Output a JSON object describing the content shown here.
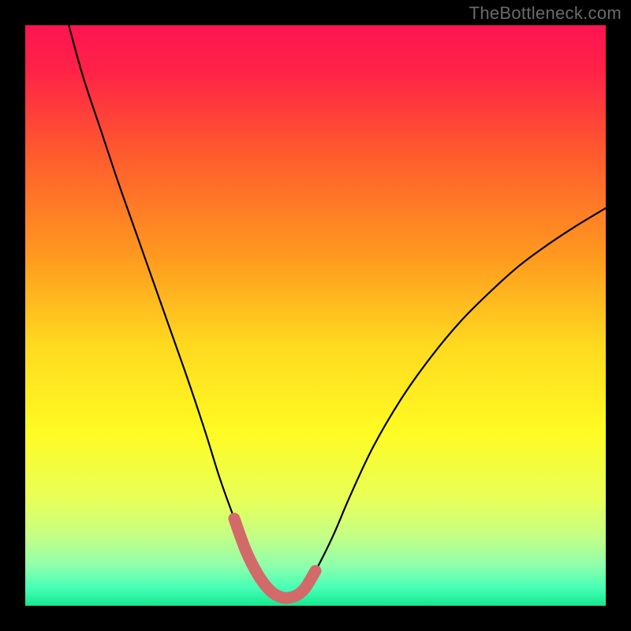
{
  "watermark": "TheBottleneck.com",
  "colors": {
    "frame_bg": "#000000",
    "gradient_stops": [
      {
        "offset": 0.0,
        "color": "#ff1452"
      },
      {
        "offset": 0.08,
        "color": "#ff2347"
      },
      {
        "offset": 0.22,
        "color": "#ff5a2e"
      },
      {
        "offset": 0.4,
        "color": "#ff9a1f"
      },
      {
        "offset": 0.55,
        "color": "#ffd91f"
      },
      {
        "offset": 0.7,
        "color": "#fffb23"
      },
      {
        "offset": 0.82,
        "color": "#e7ff5a"
      },
      {
        "offset": 0.88,
        "color": "#c4ff86"
      },
      {
        "offset": 0.93,
        "color": "#90ffab"
      },
      {
        "offset": 0.97,
        "color": "#44ffb6"
      },
      {
        "offset": 1.0,
        "color": "#17e88f"
      }
    ],
    "curve_stroke": "#000000",
    "highlight_stroke": "#d36a6a"
  },
  "chart_data": {
    "type": "line",
    "title": "",
    "xlabel": "",
    "ylabel": "",
    "xlim": [
      0,
      1
    ],
    "ylim": [
      0,
      1
    ],
    "series": [
      {
        "name": "bottleneck-curve",
        "x": [
          0.075,
          0.1,
          0.13,
          0.16,
          0.19,
          0.22,
          0.25,
          0.28,
          0.31,
          0.335,
          0.36,
          0.38,
          0.4,
          0.42,
          0.44,
          0.46,
          0.48,
          0.5,
          0.53,
          0.56,
          0.6,
          0.65,
          0.7,
          0.75,
          0.8,
          0.85,
          0.9,
          0.95,
          1.0
        ],
        "y": [
          1.0,
          0.91,
          0.82,
          0.73,
          0.645,
          0.56,
          0.475,
          0.39,
          0.3,
          0.22,
          0.15,
          0.095,
          0.055,
          0.028,
          0.015,
          0.015,
          0.028,
          0.06,
          0.12,
          0.19,
          0.275,
          0.36,
          0.43,
          0.49,
          0.54,
          0.585,
          0.622,
          0.655,
          0.685
        ]
      },
      {
        "name": "highlight-segment",
        "x": [
          0.36,
          0.38,
          0.4,
          0.42,
          0.44,
          0.46,
          0.48,
          0.5
        ],
        "y": [
          0.15,
          0.095,
          0.055,
          0.028,
          0.015,
          0.015,
          0.028,
          0.06
        ]
      }
    ]
  }
}
